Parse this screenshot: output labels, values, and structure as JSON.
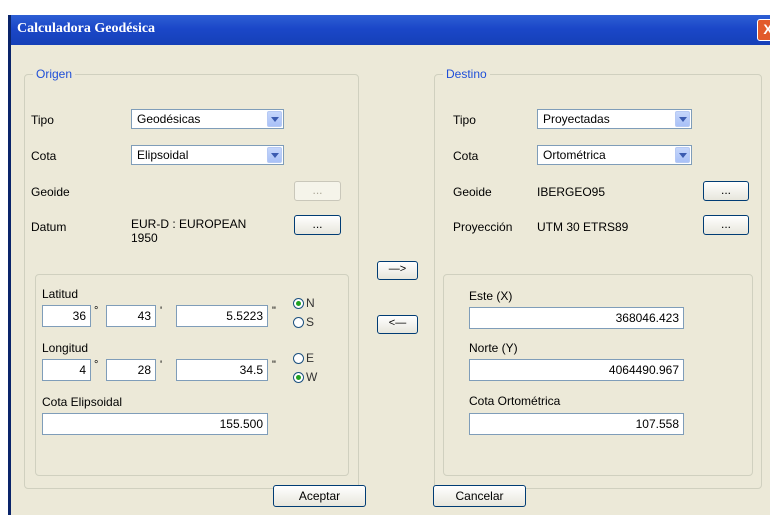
{
  "window": {
    "title": "Calculadora Geodésica",
    "close_glyph": "X"
  },
  "origen": {
    "label": "Origen",
    "tipo_label": "Tipo",
    "tipo_value": "Geodésicas",
    "cota_label": "Cota",
    "cota_value": "Elipsoidal",
    "geoide_label": "Geoide",
    "datum_label": "Datum",
    "datum_value_line1": "EUR-D : EUROPEAN",
    "datum_value_line2": "1950",
    "ellipsis": "...",
    "latitud_label": "Latitud",
    "lat_deg": "36",
    "lat_min": "43",
    "lat_sec": "5.5223",
    "longitud_label": "Longitud",
    "lon_deg": "4",
    "lon_min": "28",
    "lon_sec": "34.5",
    "deg_sym": "°",
    "min_sym": "'",
    "sec_sym": "\"",
    "radio_n": "N",
    "radio_s": "S",
    "radio_e": "E",
    "radio_w": "W",
    "selected_ns": "N",
    "selected_ew": "W",
    "cota_elip_label": "Cota Elipsoidal",
    "cota_elip_value": "155.500"
  },
  "destino": {
    "label": "Destino",
    "tipo_label": "Tipo",
    "tipo_value": "Proyectadas",
    "cota_label": "Cota",
    "cota_value": "Ortométrica",
    "geoide_label": "Geoide",
    "geoide_value": "IBERGEO95",
    "proyeccion_label": "Proyección",
    "proyeccion_value": "UTM 30 ETRS89",
    "ellipsis": "...",
    "este_label": "Este (X)",
    "este_value": "368046.423",
    "norte_label": "Norte (Y)",
    "norte_value": "4064490.967",
    "cota_orto_label": "Cota Ortométrica",
    "cota_orto_value": "107.558"
  },
  "arrows": {
    "forward": "—>",
    "back": "<—"
  },
  "footer": {
    "accept": "Aceptar",
    "cancel": "Cancelar"
  }
}
